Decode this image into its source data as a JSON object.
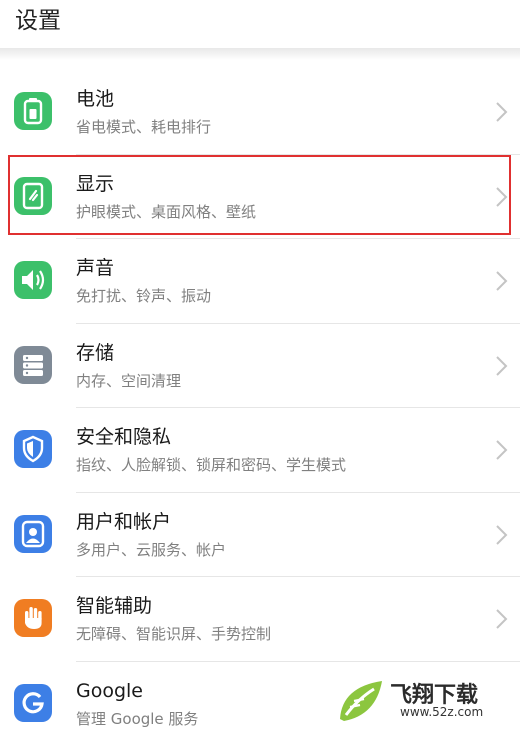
{
  "header": {
    "title": "设置"
  },
  "settings": [
    {
      "title": "电池",
      "subtitle": "省电模式、耗电排行",
      "icon": "battery-icon",
      "color": "#3cc06a"
    },
    {
      "title": "显示",
      "subtitle": "护眼模式、桌面风格、壁纸",
      "icon": "display-icon",
      "color": "#3cc06a"
    },
    {
      "title": "声音",
      "subtitle": "免打扰、铃声、振动",
      "icon": "sound-icon",
      "color": "#3cc06a"
    },
    {
      "title": "存储",
      "subtitle": "内存、空间清理",
      "icon": "storage-icon",
      "color": "#7f8a96"
    },
    {
      "title": "安全和隐私",
      "subtitle": "指纹、人脸解锁、锁屏和密码、学生模式",
      "icon": "shield-icon",
      "color": "#3d7fe6"
    },
    {
      "title": "用户和帐户",
      "subtitle": "多用户、云服务、帐户",
      "icon": "user-icon",
      "color": "#3d7fe6"
    },
    {
      "title": "智能辅助",
      "subtitle": "无障碍、智能识屏、手势控制",
      "icon": "hand-icon",
      "color": "#f07d22"
    },
    {
      "title": "Google",
      "subtitle": "管理 Google 服务",
      "icon": "google-icon",
      "color": "#3d7fe6"
    }
  ],
  "watermark": {
    "name": "飞翔下载",
    "url": "www.52z.com",
    "accent": "#8cc63f"
  }
}
